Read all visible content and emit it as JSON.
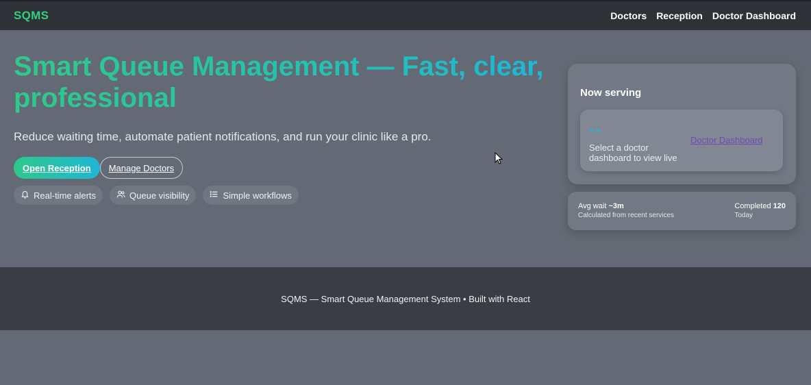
{
  "nav": {
    "brand": "SQMS",
    "links": [
      "Doctors",
      "Reception",
      "Doctor Dashboard"
    ]
  },
  "hero": {
    "headline": "Smart Queue Management — Fast, clear, professional",
    "subtitle": "Reduce waiting time, automate patient notifications, and run your clinic like a pro.",
    "primary_button": "Open Reception",
    "secondary_button": "Manage Doctors",
    "chips": [
      {
        "icon": "bell-icon",
        "label": "Real-time alerts"
      },
      {
        "icon": "users-icon",
        "label": "Queue visibility"
      },
      {
        "icon": "list-icon",
        "label": "Simple workflows"
      }
    ]
  },
  "now_serving": {
    "title": "Now serving",
    "number": "--",
    "hint": "Select a doctor dashboard to view live",
    "link": "Doctor Dashboard"
  },
  "stats": {
    "avg_wait_label": "Avg wait",
    "avg_wait_value": "~3m",
    "avg_wait_sub": "Calculated from recent services",
    "completed_label": "Completed",
    "completed_value": "120",
    "completed_sub": "Today"
  },
  "footer": {
    "text": "SQMS — Smart Queue Management System • Built with React"
  },
  "colors": {
    "brand": "#2fd07f",
    "gradient_start": "#2ec98a",
    "gradient_end": "#1db6d8",
    "link_purple": "#6e4bb8"
  }
}
